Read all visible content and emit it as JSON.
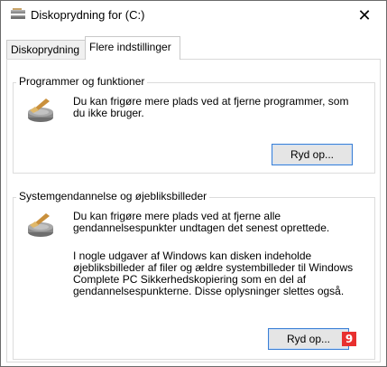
{
  "window": {
    "title": "Diskoprydning for  (C:)",
    "title_icon": "disk-cleanup-icon",
    "close_glyph": "✕"
  },
  "tabs": [
    {
      "label": "Diskoprydning",
      "active": false
    },
    {
      "label": "Flere indstillinger",
      "active": true
    }
  ],
  "programs_group": {
    "caption": "Programmer og funktioner",
    "icon": "disk-cleanup-icon",
    "description": "Du kan frigøre mere plads ved at fjerne programmer, som du ikke bruger.",
    "button_label": "Ryd op..."
  },
  "restore_group": {
    "caption": "Systemgendannelse og øjebliksbilleder",
    "icon": "disk-cleanup-icon",
    "description": "Du kan frigøre mere plads ved at fjerne alle gendannelsespunkter undtagen det senest oprettede.",
    "note": "I nogle udgaver af Windows kan disken indeholde øjebliksbilleder af filer og ældre systembilleder til Windows Complete PC Sikkerhedskopiering som en del af gendannelsespunkterne. Disse oplysninger slettes også.",
    "button_label": "Ryd op..."
  },
  "annotation": {
    "badge_number": "9",
    "badge_color": "#e8302f"
  }
}
